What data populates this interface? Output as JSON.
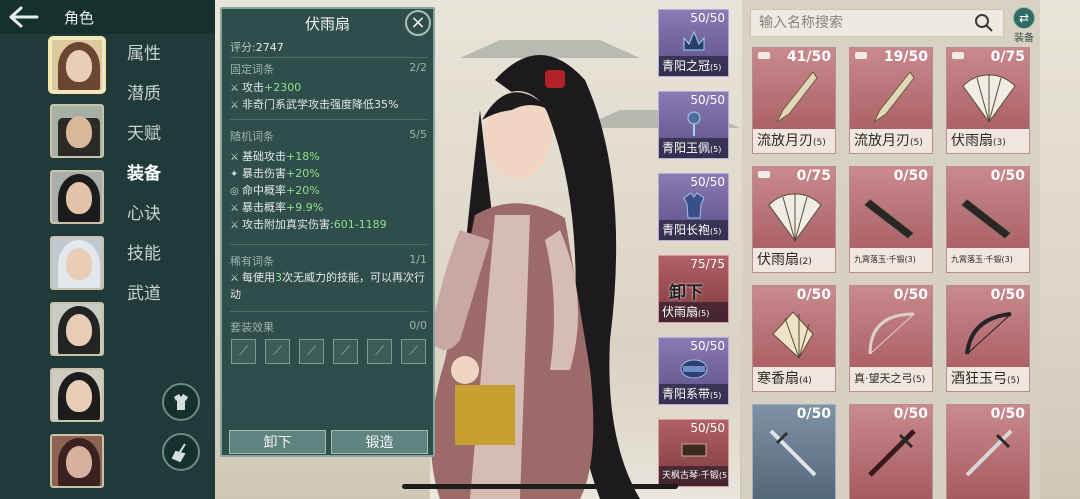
{
  "header": {
    "title": "角色"
  },
  "side_tabs": [
    "属性",
    "潜质",
    "天赋",
    "装备",
    "心诀",
    "技能",
    "武道"
  ],
  "active_tab": "装备",
  "popup": {
    "title": "伏雨扇",
    "score_label": "评分:",
    "score": "2747",
    "fixed_title": "固定词条",
    "fixed_count": "2/2",
    "fixed_lines": [
      {
        "label": "攻击",
        "value": "+2300"
      },
      {
        "label": "非奇门系武学攻击强度降低35%",
        "value": ""
      }
    ],
    "random_title": "随机词条",
    "random_count": "5/5",
    "random_lines": [
      {
        "label": "基础攻击",
        "value": "+18%"
      },
      {
        "label": "暴击伤害",
        "value": "+20%"
      },
      {
        "label": "命中概率",
        "value": "+20%"
      },
      {
        "label": "暴击概率",
        "value": "+9.9%"
      },
      {
        "label": "攻击附加真实伤害:",
        "value": "601-1189"
      }
    ],
    "rare_title": "稀有词条",
    "rare_count": "1/1",
    "rare_pre": "每使用",
    "rare_num": "3",
    "rare_post": "次无威力的技能，可以再次行动",
    "set_title": "套装效果",
    "set_count": "0/0",
    "unequip_label": "卸下",
    "forge_label": "锻造"
  },
  "equipped": [
    {
      "name": "青阳之冠",
      "level": "(5)",
      "count": "50/50"
    },
    {
      "name": "青阳玉佩",
      "level": "(5)",
      "count": "50/50"
    },
    {
      "name": "青阳长袍",
      "level": "(5)",
      "count": "50/50"
    },
    {
      "name": "伏雨扇",
      "level": "(5)",
      "count": "75/75",
      "mark": "卸下"
    },
    {
      "name": "青阳系带",
      "level": "(5)",
      "count": "50/50"
    },
    {
      "name": "天枫古琴·千锻",
      "level": "(5)",
      "count": "50/50"
    }
  ],
  "inventory": {
    "search_placeholder": "输入名称搜索",
    "filter_label": "装备",
    "items": [
      {
        "name": "流放月刃",
        "level": "(5)",
        "count": "41/50",
        "icon": "blade-icon"
      },
      {
        "name": "流放月刃",
        "level": "(5)",
        "count": "19/50",
        "icon": "blade-icon"
      },
      {
        "name": "伏雨扇",
        "level": "(3)",
        "count": "0/75",
        "icon": "fan-icon"
      },
      {
        "name": "伏雨扇",
        "level": "(2)",
        "count": "0/75",
        "icon": "fan-icon"
      },
      {
        "name": "九霄落玉·千锻",
        "level": "(3)",
        "count": "0/50",
        "icon": "zither-icon"
      },
      {
        "name": "九霄落玉·千锻",
        "level": "(3)",
        "count": "0/50",
        "icon": "zither-icon"
      },
      {
        "name": "寒香扇",
        "level": "(4)",
        "count": "0/50",
        "icon": "fan-icon"
      },
      {
        "name": "真·望天之弓",
        "level": "(5)",
        "count": "0/50",
        "icon": "bow-icon"
      },
      {
        "name": "酒狂玉弓",
        "level": "(5)",
        "count": "0/50",
        "icon": "bow-icon"
      },
      {
        "name": "",
        "level": "",
        "count": "0/50",
        "icon": "sword-icon"
      },
      {
        "name": "",
        "level": "",
        "count": "0/50",
        "icon": "sword-icon"
      },
      {
        "name": "",
        "level": "",
        "count": "0/50",
        "icon": "sword-icon"
      }
    ]
  },
  "colors": {
    "sidebar": "#1f3a38",
    "popup": "#2f4d4a",
    "card_red": "#a3555b",
    "card_blue": "#4e6278",
    "equip_purple": "#5c4f86",
    "stat_green": "#8fe08a"
  }
}
